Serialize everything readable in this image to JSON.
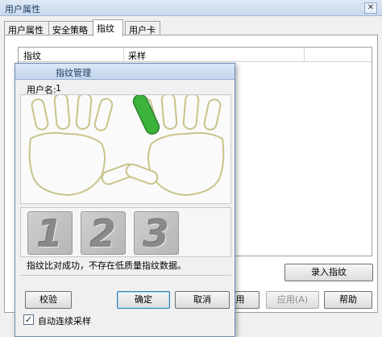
{
  "window": {
    "title": "用户属性",
    "close_glyph": "✕",
    "tabs": [
      {
        "label": "用户属性"
      },
      {
        "label": "安全策略"
      },
      {
        "label": "指纹"
      },
      {
        "label": "用户卡"
      }
    ],
    "active_tab": "指纹",
    "list_columns": [
      "指纹",
      "采样"
    ],
    "enroll_button": "录入指纹",
    "bottom_buttons": {
      "ok_partial": "用",
      "apply": "应用(A)",
      "help": "帮助"
    }
  },
  "dialog": {
    "title": "指纹管理",
    "user_label": "用户名:",
    "user_value": "1",
    "selected_finger": "left-index",
    "digits": [
      "1",
      "2",
      "3"
    ],
    "status": "指纹比对成功，不存在低质量指纹数据。",
    "buttons": {
      "verify": "校验",
      "ok": "确定",
      "cancel": "取消"
    },
    "auto_sample": {
      "label": "自动连续采样",
      "checked": true,
      "glyph": "✓"
    }
  },
  "colors": {
    "finger_selected": "#3cb43c",
    "finger_outline": "#c8c48a",
    "accent": "#3c7fb1"
  }
}
